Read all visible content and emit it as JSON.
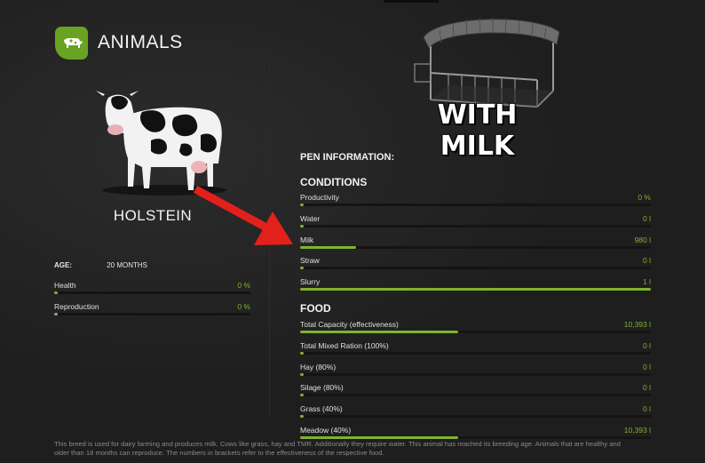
{
  "header": {
    "title": "ANIMALS",
    "icon": "cow-icon",
    "accent": "#6aa323"
  },
  "animal": {
    "name": "HOLSTEIN",
    "age_label": "AGE:",
    "age_value": "20 MONTHS",
    "stats": [
      {
        "label": "Health",
        "value": "0 %",
        "fraction": 0.0
      },
      {
        "label": "Reproduction",
        "value": "0 %",
        "fraction": 0.0
      }
    ]
  },
  "pen": {
    "title": "WITH MILK",
    "info_label": "PEN INFORMATION:",
    "conditions_title": "CONDITIONS",
    "conditions": [
      {
        "label": "Productivity",
        "value": "0 %",
        "fraction": 0.0
      },
      {
        "label": "Water",
        "value": "0 l",
        "fraction": 0.0
      },
      {
        "label": "Milk",
        "value": "980 l",
        "fraction": 0.16
      },
      {
        "label": "Straw",
        "value": "0 l",
        "fraction": 0.0
      },
      {
        "label": "Slurry",
        "value": "1 l",
        "fraction": 1.0
      }
    ],
    "food_title": "FOOD",
    "food": [
      {
        "label": "Total Capacity (effectiveness)",
        "value": "10,393 l",
        "fraction": 0.45
      },
      {
        "label": "Total Mixed Ration (100%)",
        "value": "0 l",
        "fraction": 0.0
      },
      {
        "label": "Hay (80%)",
        "value": "0 l",
        "fraction": 0.0
      },
      {
        "label": "Silage (80%)",
        "value": "0 l",
        "fraction": 0.0
      },
      {
        "label": "Grass (40%)",
        "value": "0 l",
        "fraction": 0.0
      },
      {
        "label": "Meadow (40%)",
        "value": "10,393 l",
        "fraction": 0.45
      }
    ]
  },
  "footer": {
    "note": "This breed is used for dairy farming and produces milk. Cows like grass, hay and TMR. Additionally they require water. This animal has reached its breeding age. Animals that are healthy and older than 18 months can reproduce. The numbers in brackets refer to the effectiveness of the respective food."
  },
  "colors": {
    "bar_fill": "#7fb32f",
    "value_text": "#7fb32f",
    "arrow": "#e3201b",
    "background": "#1e1e1e"
  }
}
